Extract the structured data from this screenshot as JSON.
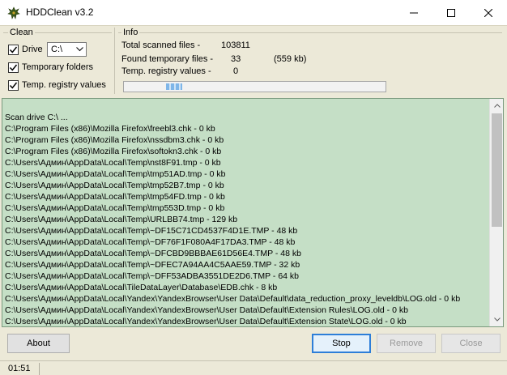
{
  "window": {
    "title": "HDDClean v3.2"
  },
  "clean_group": {
    "title": "Clean",
    "drive": {
      "label": "Drive",
      "checked": true,
      "selected": "C:\\"
    },
    "temp_folders": {
      "label": "Temporary folders",
      "checked": true
    },
    "temp_registry": {
      "label": "Temp. registry values",
      "checked": true
    }
  },
  "info_group": {
    "title": "Info",
    "total_label": "Total scanned files -",
    "total_value": "103811",
    "found_label": "Found temporary files -",
    "found_value": "33",
    "found_size": "(559 kb)",
    "registry_label": "Temp. registry values -",
    "registry_value": "0"
  },
  "log": {
    "lines": [
      "Scan drive C:\\ ...",
      "C:\\Program Files (x86)\\Mozilla Firefox\\freebl3.chk - 0 kb",
      "C:\\Program Files (x86)\\Mozilla Firefox\\nssdbm3.chk - 0 kb",
      "C:\\Program Files (x86)\\Mozilla Firefox\\softokn3.chk - 0 kb",
      "C:\\Users\\Админ\\AppData\\Local\\Temp\\nst8F91.tmp - 0 kb",
      "C:\\Users\\Админ\\AppData\\Local\\Temp\\tmp51AD.tmp - 0 kb",
      "C:\\Users\\Админ\\AppData\\Local\\Temp\\tmp52B7.tmp - 0 kb",
      "C:\\Users\\Админ\\AppData\\Local\\Temp\\tmp54FD.tmp - 0 kb",
      "C:\\Users\\Админ\\AppData\\Local\\Temp\\tmp553D.tmp - 0 kb",
      "C:\\Users\\Админ\\AppData\\Local\\Temp\\URLBB74.tmp - 129 kb",
      "C:\\Users\\Админ\\AppData\\Local\\Temp\\~DF15C71CD4537F4D1E.TMP - 48 kb",
      "C:\\Users\\Админ\\AppData\\Local\\Temp\\~DF76F1F080A4F17DA3.TMP - 48 kb",
      "C:\\Users\\Админ\\AppData\\Local\\Temp\\~DFCBD9BBBAE61D56E4.TMP - 48 kb",
      "C:\\Users\\Админ\\AppData\\Local\\Temp\\~DFEC7A94AA4C5AAE59.TMP - 32 kb",
      "C:\\Users\\Админ\\AppData\\Local\\Temp\\~DFF53ADBA3551DE2D6.TMP - 64 kb",
      "C:\\Users\\Админ\\AppData\\Local\\TileDataLayer\\Database\\EDB.chk - 8 kb",
      "C:\\Users\\Админ\\AppData\\Local\\Yandex\\YandexBrowser\\User Data\\Default\\data_reduction_proxy_leveldb\\LOG.old - 0 kb",
      "C:\\Users\\Админ\\AppData\\Local\\Yandex\\YandexBrowser\\User Data\\Default\\Extension Rules\\LOG.old - 0 kb",
      "C:\\Users\\Админ\\AppData\\Local\\Yandex\\YandexBrowser\\User Data\\Default\\Extension State\\LOG.old - 0 kb"
    ]
  },
  "buttons": {
    "about": "About",
    "stop": "Stop",
    "remove": "Remove",
    "close": "Close"
  },
  "status": {
    "elapsed": "01:51"
  },
  "colors": {
    "log_bg": "#c5dfc6",
    "accent": "#2d7ed8"
  }
}
